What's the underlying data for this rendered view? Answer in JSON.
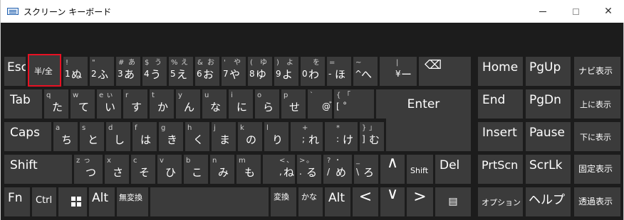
{
  "window": {
    "title": "スクリーン キーボード"
  },
  "colors": {
    "background": "#1c1c1c",
    "key": "#3b3b3b",
    "highlight": "#e81123"
  },
  "keys": {
    "esc": "Esc",
    "hankaku": "半/全",
    "n1": {
      "s1": "!",
      "s2": "",
      "m": "1",
      "k": "ぬ"
    },
    "n2": {
      "s1": "\"",
      "s2": "",
      "m": "2",
      "k": "ふ"
    },
    "n3": {
      "s1": "#",
      "s2": "あ",
      "m": "3",
      "k": "あ"
    },
    "n4": {
      "s1": "$",
      "s2": "う",
      "m": "4",
      "k": "う"
    },
    "n5": {
      "s1": "%",
      "s2": "え",
      "m": "5",
      "k": "え"
    },
    "n6": {
      "s1": "&",
      "s2": "お",
      "m": "6",
      "k": "お"
    },
    "n7": {
      "s1": "'",
      "s2": "や",
      "m": "7",
      "k": "や"
    },
    "n8": {
      "s1": "(",
      "s2": "ゆ",
      "m": "8",
      "k": "ゆ"
    },
    "n9": {
      "s1": ")",
      "s2": "よ",
      "m": "9",
      "k": "よ"
    },
    "n0": {
      "s1": "",
      "s2": "を",
      "m": "0",
      "k": "わ"
    },
    "minus": {
      "s1": "=",
      "s2": "",
      "m": "-",
      "k": "ほ"
    },
    "caret": {
      "s1": "~",
      "s2": "",
      "m": "^",
      "k": "へ"
    },
    "yen": {
      "s1": "|",
      "s2": "",
      "m": "¥",
      "k": "ー"
    },
    "tab": "Tab",
    "q": {
      "s": "q",
      "k": "た"
    },
    "w": {
      "s": "w",
      "k": "て"
    },
    "e": {
      "s": "e",
      "s2": "ぃ",
      "k": "い"
    },
    "r": {
      "s": "r",
      "k": "す"
    },
    "t": {
      "s": "t",
      "k": "か"
    },
    "y": {
      "s": "y",
      "k": "ん"
    },
    "u": {
      "s": "u",
      "k": "な"
    },
    "i": {
      "s": "i",
      "k": "に"
    },
    "o": {
      "s": "o",
      "k": "ら"
    },
    "p": {
      "s": "p",
      "k": "せ"
    },
    "at": {
      "s": "`",
      "k1": "@",
      "k2": "゛"
    },
    "lbr": {
      "s1": "{",
      "s2": "「",
      "k1": "[",
      "k2": "゜"
    },
    "enter": "Enter",
    "caps": "Caps",
    "a": {
      "s": "a",
      "k": "ち"
    },
    "s": {
      "s": "s",
      "k": "と"
    },
    "d": {
      "s": "d",
      "k": "し"
    },
    "f": {
      "s": "f",
      "k": "は"
    },
    "g": {
      "s": "g",
      "k": "き"
    },
    "h": {
      "s": "h",
      "k": "く"
    },
    "j": {
      "s": "j",
      "k": "ま"
    },
    "k": {
      "s": "k",
      "k": "の"
    },
    "l": {
      "s": "l",
      "k": "り"
    },
    "semi": {
      "s": "+",
      "k1": ";",
      "k2": "れ"
    },
    "colon": {
      "s": "*",
      "k1": ":",
      "k2": "け"
    },
    "rbr": {
      "s1": "}",
      "s2": "」",
      "k1": "]",
      "k2": "む"
    },
    "shift": "Shift",
    "z": {
      "s1": "z",
      "s2": "っ",
      "k": "つ"
    },
    "x": {
      "s": "x",
      "k": "さ"
    },
    "c": {
      "s": "c",
      "k": "そ"
    },
    "v": {
      "s": "v",
      "k": "ひ"
    },
    "b": {
      "s": "b",
      "k": "こ"
    },
    "n": {
      "s": "n",
      "k": "み"
    },
    "m": {
      "s": "m",
      "k": "も"
    },
    "comma": {
      "s1": "<",
      "s2": "、",
      "k1": ",",
      "k2": "ね"
    },
    "period": {
      "s1": ">",
      "s2": "。",
      "k1": ".",
      "k2": "る"
    },
    "slash": {
      "s1": "?",
      "s2": "・",
      "k1": "/",
      "k2": "め"
    },
    "bslash": {
      "s": "_",
      "k1": "\\",
      "k2": "ろ"
    },
    "up_arrow": "∧",
    "rshift": "Shift",
    "del": "Del",
    "fn": "Fn",
    "ctrl": "Ctrl",
    "alt": "Alt",
    "muhenkan": "無変換",
    "henkan": "変換",
    "kana": "かな",
    "ralt": "Alt",
    "left_arrow": "<",
    "down_arrow": "∨",
    "right_arrow": ">",
    "menu": "▤",
    "home": "Home",
    "pgup": "PgUp",
    "navi": "ナビ表示",
    "end": "End",
    "pgdn": "PgDn",
    "upshow": "上に表示",
    "insert": "Insert",
    "pause": "Pause",
    "downshow": "下に表示",
    "prtscn": "PrtScn",
    "scrlk": "ScrLk",
    "fixshow": "固定表示",
    "options": "オプション",
    "help": "ヘルプ",
    "fadeshow": "透過表示",
    "backspace": "⌫"
  }
}
